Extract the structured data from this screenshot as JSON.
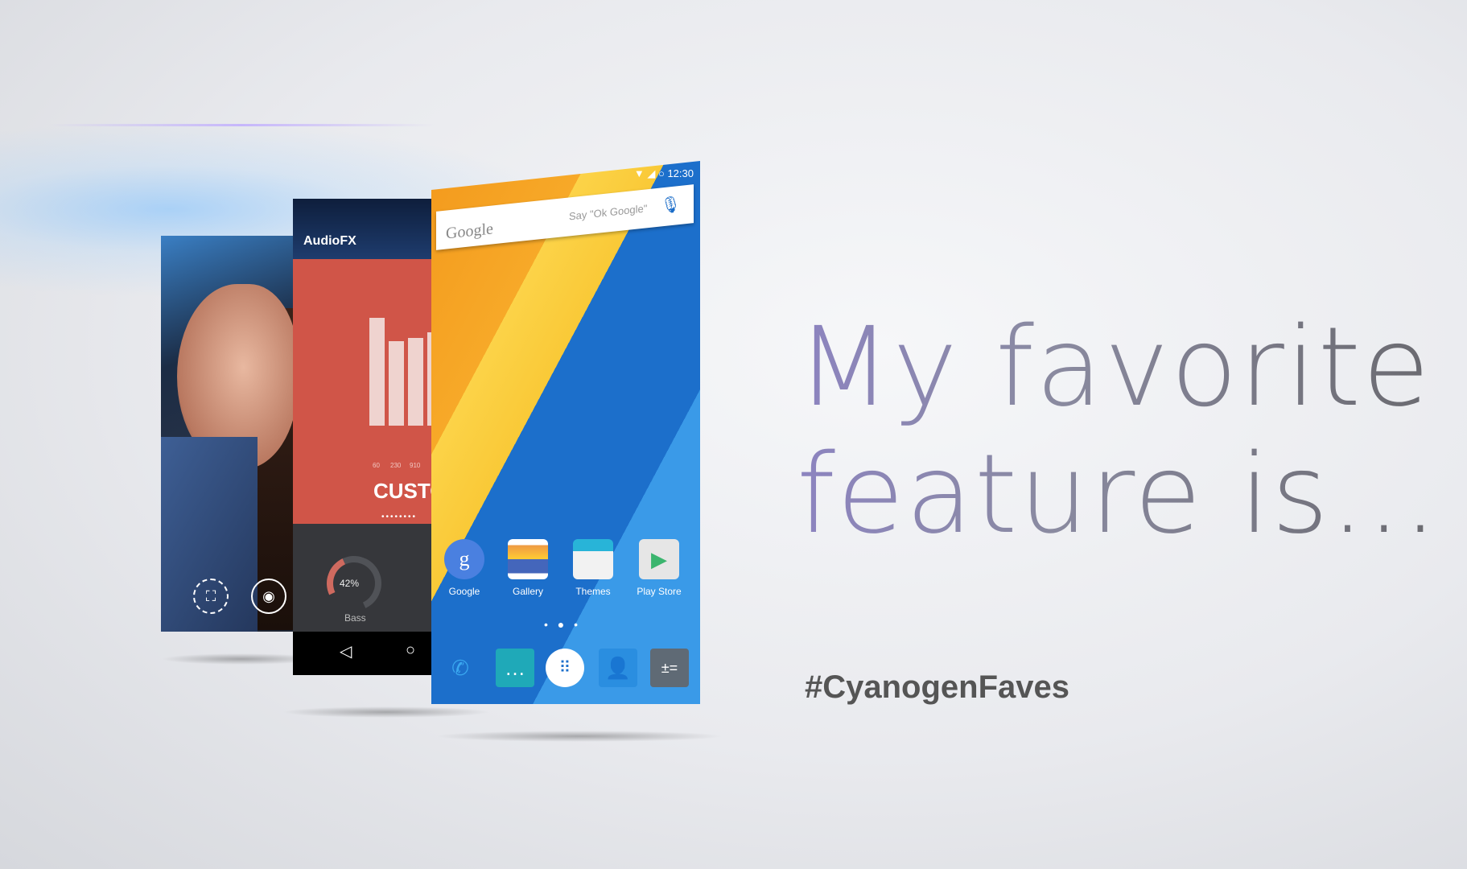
{
  "colors": {
    "audiofx": "#d05548",
    "home_blue": "#1c6fcb",
    "accent_text": "#8c84c0",
    "hashtag": "#555555"
  },
  "camera": {
    "icons": [
      "panorama-icon",
      "camera-icon"
    ]
  },
  "audiofx": {
    "title": "AudioFX",
    "freqs": [
      "60",
      "230",
      "910"
    ],
    "eq_levels": [
      0.88,
      0.69,
      0.72
    ],
    "preset": "CUSTO",
    "dots": "••••••••",
    "bass_percent": "42%",
    "bass_value": 42,
    "bass_label": "Bass"
  },
  "home": {
    "time": "12:30",
    "search_logo": "Google",
    "search_hint": "Say \"Ok Google\"",
    "apps": [
      {
        "label": "Google",
        "icon": "g"
      },
      {
        "label": "Gallery",
        "icon": "▤"
      },
      {
        "label": "Themes",
        "icon": "▥"
      },
      {
        "label": "Play Store",
        "icon": "▶"
      }
    ],
    "pager": "• ● •",
    "page_index": 2,
    "page_count": 3,
    "dock": [
      "phone-icon",
      "messaging-icon",
      "app-drawer-icon",
      "contacts-icon",
      "calculator-icon"
    ]
  },
  "headline": {
    "line1": "My favorite",
    "line2": "feature is..."
  },
  "hashtag": "#CyanogenFaves"
}
